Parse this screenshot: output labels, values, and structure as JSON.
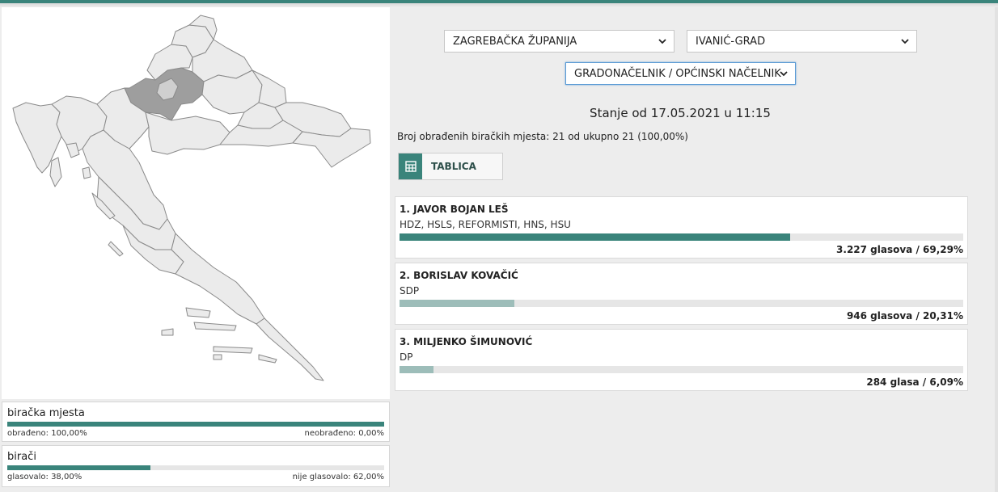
{
  "colors": {
    "accent": "#3a847b",
    "muted": "#9dbdb9",
    "track": "#e6e6e6",
    "region_highlight": "#9e9e9e",
    "region_base": "#ebebeb"
  },
  "filters": {
    "county": {
      "value": "ZAGREBAČKA ŽUPANIJA",
      "icon": "chevron-down-icon"
    },
    "municipality": {
      "value": "IVANIĆ-GRAD",
      "icon": "chevron-down-icon"
    },
    "election_type": {
      "value": "GRADONAČELNIK / OPĆINSKI NAČELNIK",
      "icon": "chevron-down-icon"
    }
  },
  "status": {
    "title": "Stanje od 17.05.2021 u 11:15",
    "processed": "Broj obrađenih biračkih mjesta: 21 od ukupno 21 (100,00%)"
  },
  "view_toggle": {
    "label": "TABLICA",
    "icon": "table-icon"
  },
  "candidates": [
    {
      "name": "1. JAVOR BOJAN LEŠ",
      "party": "HDZ, HSLS, REFORMISTI, HNS, HSU",
      "share": 69.29,
      "votes": "3.227 glasova / 69,29%"
    },
    {
      "name": "2. BORISLAV KOVAČIĆ",
      "party": "SDP",
      "share": 20.31,
      "votes": "946 glasova / 20,31%"
    },
    {
      "name": "3. MILJENKO ŠIMUNOVIĆ",
      "party": "DP",
      "share": 6.09,
      "votes": "284 glasa / 6,09%"
    }
  ],
  "stats": {
    "polling_stations": {
      "title": "biračka mjesta",
      "left": "obrađeno: 100,00%",
      "right": "neobrađeno: 0,00%",
      "share": 100
    },
    "voters": {
      "title": "birači",
      "left": "glasovalo: 38,00%",
      "right": "nije glasovalo: 62,00%",
      "share": 38
    }
  }
}
